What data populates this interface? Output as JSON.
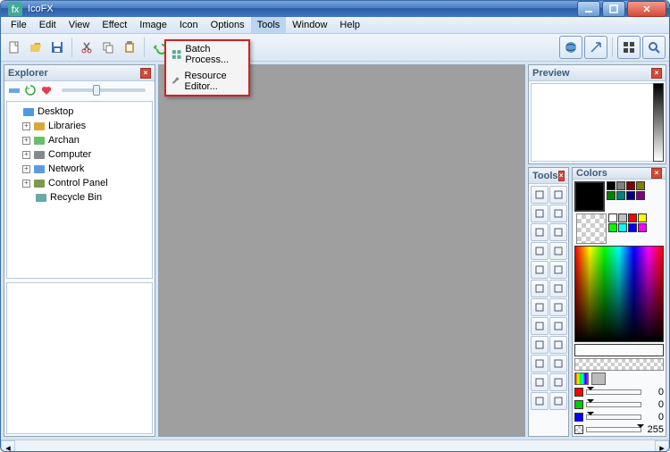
{
  "window": {
    "title": "IcoFX"
  },
  "menubar": {
    "items": [
      "File",
      "Edit",
      "View",
      "Effect",
      "Image",
      "Icon",
      "Options",
      "Tools",
      "Window",
      "Help"
    ],
    "active_index": 7
  },
  "tools_menu": {
    "items": [
      {
        "label": "Batch Process...",
        "icon": "grid-icon"
      },
      {
        "label": "Resource Editor...",
        "icon": "wrench-icon"
      }
    ]
  },
  "panels": {
    "explorer": {
      "title": "Explorer"
    },
    "preview": {
      "title": "Preview"
    },
    "tools": {
      "title": "Tools"
    },
    "colors": {
      "title": "Colors"
    }
  },
  "explorer_tree": [
    {
      "label": "Desktop",
      "icon": "desktop",
      "level": 0,
      "expandable": false
    },
    {
      "label": "Libraries",
      "icon": "libraries",
      "level": 1,
      "expandable": true
    },
    {
      "label": "Archan",
      "icon": "user",
      "level": 1,
      "expandable": true
    },
    {
      "label": "Computer",
      "icon": "computer",
      "level": 1,
      "expandable": true
    },
    {
      "label": "Network",
      "icon": "network",
      "level": 1,
      "expandable": true
    },
    {
      "label": "Control Panel",
      "icon": "cpanel",
      "level": 1,
      "expandable": true
    },
    {
      "label": "Recycle Bin",
      "icon": "recycle",
      "level": 1,
      "expandable": false
    }
  ],
  "color_values": {
    "r": 0,
    "g": 0,
    "b": 0,
    "a": 255
  },
  "swatches": [
    "#000000",
    "#808080",
    "#800000",
    "#808000",
    "#008000",
    "#008080",
    "#000080",
    "#800080",
    "#ffffff",
    "#c0c0c0",
    "#ff0000",
    "#ffff00",
    "#00ff00",
    "#00ffff",
    "#0000ff",
    "#ff00ff"
  ],
  "chart_data": null
}
